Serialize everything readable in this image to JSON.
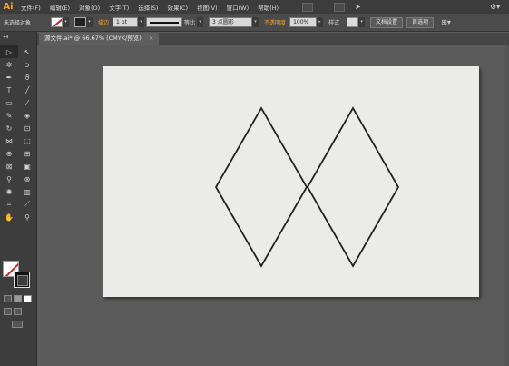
{
  "app": {
    "logo": "Ai"
  },
  "menu": [
    "文件(F)",
    "编辑(E)",
    "对象(O)",
    "文字(T)",
    "选择(S)",
    "效果(C)",
    "视图(V)",
    "窗口(W)",
    "帮助(H)"
  ],
  "control_bar": {
    "selection_status": "未选择对象",
    "stroke_label": "描边",
    "stroke_weight": "1 pt",
    "stroke_profile": "等比",
    "brush": "3 点圆形",
    "opacity_label": "不透明度",
    "opacity_value": "100%",
    "style_label": "样式",
    "document_setup_button": "文档设置",
    "preferences_button": "首选项"
  },
  "document_tab": {
    "title": "源文件.ai* @ 66.67% (CMYK/预览)",
    "close_glyph": "×"
  },
  "tools": [
    "selection-tool",
    "direct-selection-tool",
    "magic-wand-tool",
    "lasso-tool",
    "pen-tool",
    "curvature-tool",
    "type-tool",
    "line-segment-tool",
    "rectangle-tool",
    "paintbrush-tool",
    "pencil-tool",
    "eraser-tool",
    "rotate-tool",
    "scale-tool",
    "width-tool",
    "free-transform-tool",
    "shape-builder-tool",
    "perspective-grid-tool",
    "mesh-tool",
    "gradient-tool",
    "eyedropper-tool",
    "blend-tool",
    "symbol-sprayer-tool",
    "column-graph-tool",
    "artboard-tool",
    "slice-tool",
    "hand-tool",
    "zoom-tool"
  ],
  "tool_glyphs": [
    "▷",
    "↖",
    "✲",
    "ↄ",
    "✒",
    "ϑ",
    "T",
    "╱",
    "▭",
    "⁄",
    "✎",
    "◈",
    "↻",
    "⊡",
    "⋈",
    "⬚",
    "⊕",
    "⊞",
    "⊠",
    "▣",
    "⚲",
    "⊗",
    "✺",
    "▥",
    "⌗",
    "⟋",
    "✋",
    "⚲"
  ],
  "colors": {
    "accent_orange": "#f0a03c",
    "canvas_bg": "#5a5a5a",
    "artboard_bg": "#ebebea",
    "none_slash": "#d02020",
    "shape_stroke": "#222222"
  }
}
